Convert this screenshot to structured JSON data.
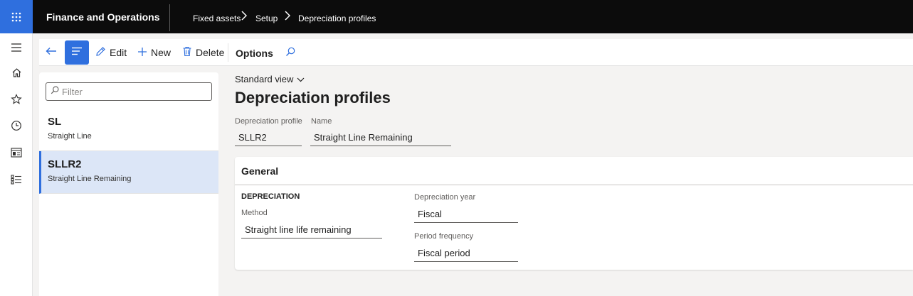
{
  "app": {
    "title": "Finance and Operations"
  },
  "breadcrumb": [
    "Fixed assets",
    "Setup",
    "Depreciation profiles"
  ],
  "action_pane": {
    "edit_label": "Edit",
    "new_label": "New",
    "delete_label": "Delete",
    "options_label": "Options"
  },
  "list": {
    "filter_placeholder": "Filter",
    "items": [
      {
        "code": "SL",
        "name": "Straight Line",
        "selected": false
      },
      {
        "code": "SLLR2",
        "name": "Straight Line Remaining",
        "selected": true
      }
    ]
  },
  "main": {
    "view_label": "Standard view",
    "page_title": "Depreciation profiles",
    "header_fields": {
      "profile_label": "Depreciation profile",
      "profile_value": "SLLR2",
      "name_label": "Name",
      "name_value": "Straight Line Remaining"
    },
    "general": {
      "title": "General",
      "group_title": "DEPRECIATION",
      "method_label": "Method",
      "method_value": "Straight line life remaining",
      "year_label": "Depreciation year",
      "year_value": "Fiscal",
      "frequency_label": "Period frequency",
      "frequency_value": "Fiscal period"
    }
  },
  "colors": {
    "accent": "#2f6fde",
    "topbar": "#0c0c0c",
    "selected_row": "#dce6f7"
  },
  "icons": [
    "waffle-icon",
    "hamburger-icon",
    "home-icon",
    "star-icon",
    "clock-icon",
    "workspace-icon",
    "list-icon",
    "back-arrow-icon",
    "list-view-icon",
    "pencil-icon",
    "plus-icon",
    "trash-icon",
    "search-icon",
    "chevron-down-icon"
  ]
}
